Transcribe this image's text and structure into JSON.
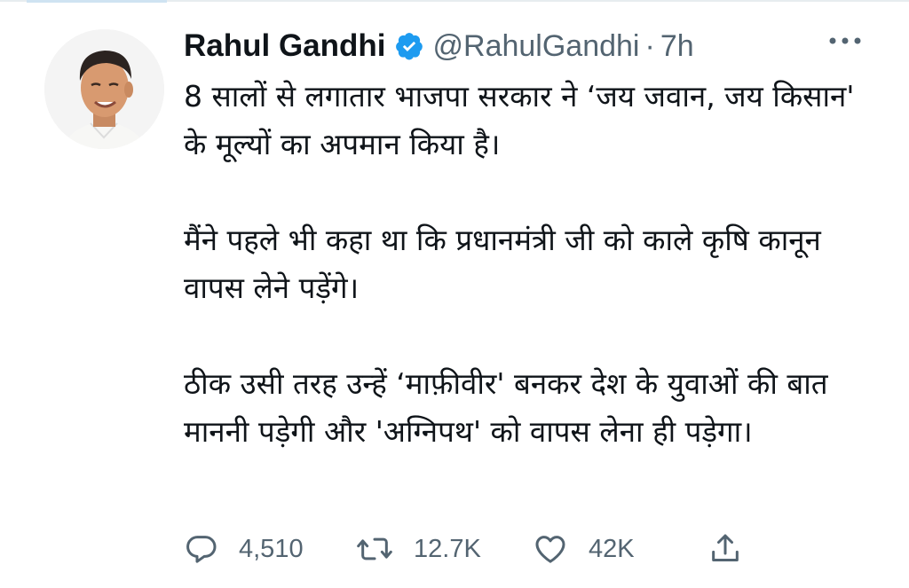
{
  "tweet": {
    "author": {
      "display_name": "Rahul Gandhi",
      "handle": "@RahulGandhi",
      "verified": true
    },
    "separator": "·",
    "time": "7h",
    "paragraphs": [
      "8 सालों से लगातार भाजपा सरकार ने ‘जय जवान, जय किसान' के मूल्यों का अपमान किया है।",
      "मैंने पहले भी कहा था कि प्रधानमंत्री जी को काले कृषि कानून वापस लेने पड़ेंगे।",
      "ठीक उसी तरह उन्हें ‘माफ़ीवीर' बनकर देश के युवाओं की बात माननी पड़ेगी और 'अग्निपथ' को वापस लेना ही पड़ेगा।"
    ],
    "stats": {
      "replies": "4,510",
      "retweets": "12.7K",
      "likes": "42K"
    }
  },
  "colors": {
    "text_primary": "#0f1419",
    "text_secondary": "#536471",
    "verified_blue": "#1d9bf0",
    "divider": "#e7ecef"
  },
  "icons": {
    "verified": "verified-badge-icon",
    "more": "more-horizontal-icon",
    "reply": "reply-bubble-icon",
    "retweet": "retweet-arrows-icon",
    "like": "heart-icon",
    "share": "share-upload-icon"
  }
}
